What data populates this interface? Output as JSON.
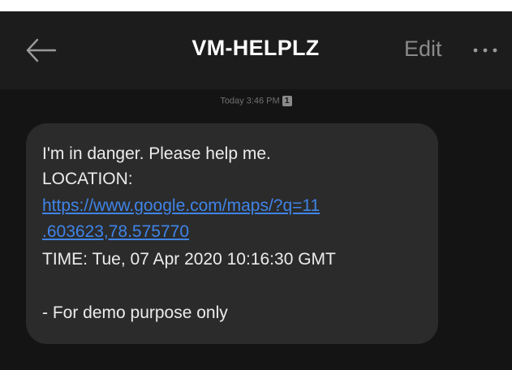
{
  "header": {
    "title": "VM-HELPLZ",
    "edit_label": "Edit",
    "back_icon": "arrow-left-icon",
    "more_icon": "more-dots-icon"
  },
  "conversation": {
    "timestamp": "Today 3:46 PM",
    "sim_badge": "1"
  },
  "message": {
    "line1": "I'm in danger. Please help me.",
    "line2": "LOCATION:",
    "link_line1": "https://www.google.com/maps/?q=11",
    "link_line2": ".603623,78.575770",
    "line3": "TIME: Tue, 07 Apr 2020 10:16:30 GMT",
    "line4": "- For demo purpose only"
  },
  "colors": {
    "background": "#141414",
    "header": "#1c1c1c",
    "bubble": "#2b2b2b",
    "link": "#3f84e8",
    "text": "#ececec",
    "muted": "#8a8a8a"
  }
}
